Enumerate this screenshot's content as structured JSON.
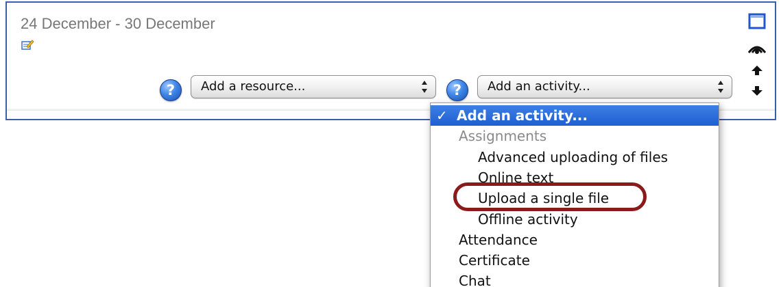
{
  "section": {
    "title": "24 December - 30 December"
  },
  "resource_picker": {
    "selected": "Add a resource..."
  },
  "activity_picker": {
    "selected": "Add an activity...",
    "options": [
      {
        "label": "Add an activity...",
        "kind": "selected",
        "check": "✓"
      },
      {
        "label": "Assignments",
        "kind": "group"
      },
      {
        "label": "Advanced uploading of files",
        "kind": "sub"
      },
      {
        "label": "Online text",
        "kind": "sub"
      },
      {
        "label": "Upload a single file",
        "kind": "sub",
        "highlighted": true
      },
      {
        "label": "Offline activity",
        "kind": "sub"
      },
      {
        "label": "Attendance",
        "kind": "top"
      },
      {
        "label": "Certificate",
        "kind": "top"
      },
      {
        "label": "Chat",
        "kind": "top"
      }
    ]
  },
  "help_icon_glyph": "?",
  "colors": {
    "section_border": "#3a5fa8",
    "selection_blue": "#2a6ddc",
    "highlight_ring": "#8b1a1a",
    "group_text": "#8a8a8a"
  },
  "icons": [
    "edit-icon",
    "collapse-icon",
    "visibility-eye-icon",
    "move-up-icon",
    "move-down-icon",
    "help-icon",
    "select-arrows-icon"
  ]
}
